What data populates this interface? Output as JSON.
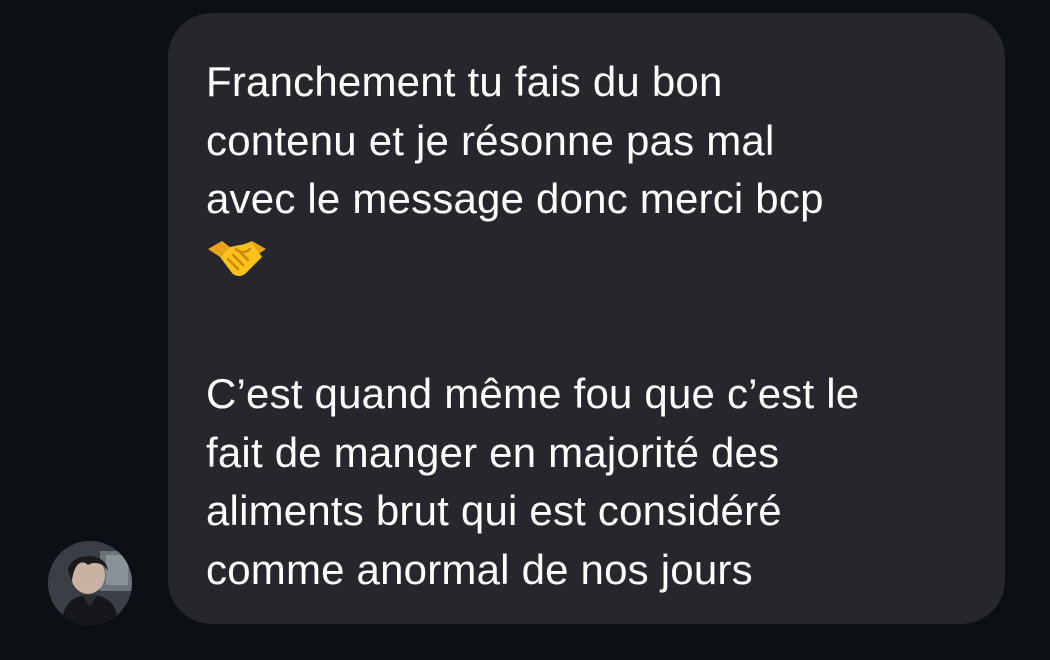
{
  "message": {
    "lines_part1": [
      "Franchement tu fais du bon",
      "contenu et je résonne pas mal",
      "avec le message donc merci bcp"
    ],
    "emoji": "handshake-emoji",
    "lines_part2": [
      "C’est quand même fou que c’est le",
      "fait de manger en majorité des",
      "aliments brut qui est considéré",
      "comme anormal de nos jours"
    ]
  },
  "sender": {
    "avatar": "profile-photo"
  },
  "colors": {
    "background": "#0c0f14",
    "bubble": "#25272c",
    "text": "#ffffff"
  }
}
